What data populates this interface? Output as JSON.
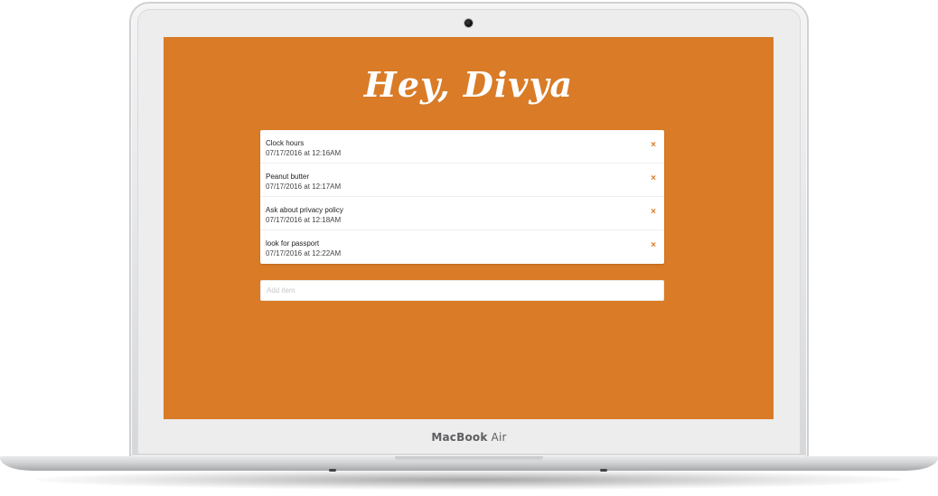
{
  "device": {
    "brand_bold": "MacBook",
    "brand_light": "Air"
  },
  "app": {
    "greeting": "Hey, Divya",
    "accent_color": "#d97b27",
    "items": [
      {
        "title": "Clock hours",
        "date": "07/17/2016 at 12:16AM",
        "remove_icon": "close-icon"
      },
      {
        "title": "Peanut butter",
        "date": "07/17/2016 at 12:17AM",
        "remove_icon": "close-icon"
      },
      {
        "title": "Ask about privacy policy",
        "date": "07/17/2016 at 12:18AM",
        "remove_icon": "close-icon"
      },
      {
        "title": "look for passport",
        "date": "07/17/2016 at 12:22AM",
        "remove_icon": "close-icon"
      }
    ],
    "remove_glyph": "×",
    "add_item": {
      "placeholder": "Add item",
      "value": ""
    }
  }
}
